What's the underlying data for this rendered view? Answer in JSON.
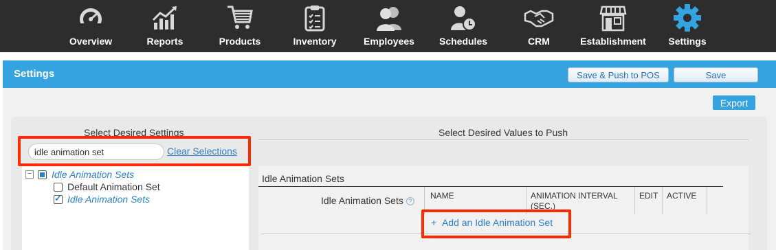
{
  "nav": {
    "items": [
      {
        "label": "Overview",
        "icon": "speedometer-icon"
      },
      {
        "label": "Reports",
        "icon": "bar-chart-icon"
      },
      {
        "label": "Products",
        "icon": "shopping-cart-icon"
      },
      {
        "label": "Inventory",
        "icon": "clipboard-icon"
      },
      {
        "label": "Employees",
        "icon": "users-icon"
      },
      {
        "label": "Schedules",
        "icon": "user-clock-icon"
      },
      {
        "label": "CRM",
        "icon": "handshake-icon"
      },
      {
        "label": "Establishment",
        "icon": "storefront-icon"
      },
      {
        "label": "Settings",
        "icon": "gear-icon",
        "active": true
      }
    ],
    "active_color": "#35a3df"
  },
  "header": {
    "title": "Settings",
    "save_push_label": "Save & Push to POS",
    "save_label": "Save",
    "accent": "#35a3df"
  },
  "export_label": "Export",
  "left": {
    "title": "Select Desired Settings",
    "search_value": "idle animation set",
    "clear_label": "Clear Selections",
    "tree": {
      "expander": "−",
      "root": "Idle Animation Sets",
      "children": [
        {
          "label": "Default Animation Set",
          "checked": false
        },
        {
          "label": "Idle Animation Sets",
          "checked": true
        }
      ]
    }
  },
  "right": {
    "title": "Select Desired Values to Push",
    "section_title": "Idle Animation Sets",
    "field_label": "Idle Animation Sets",
    "help": "?",
    "columns": [
      "NAME",
      "ANIMATION INTERVAL (SEC.)",
      "EDIT",
      "ACTIVE"
    ],
    "add_label": "Add an Idle Animation Set",
    "add_prefix": "+"
  },
  "highlight_color": "#ff2a00"
}
